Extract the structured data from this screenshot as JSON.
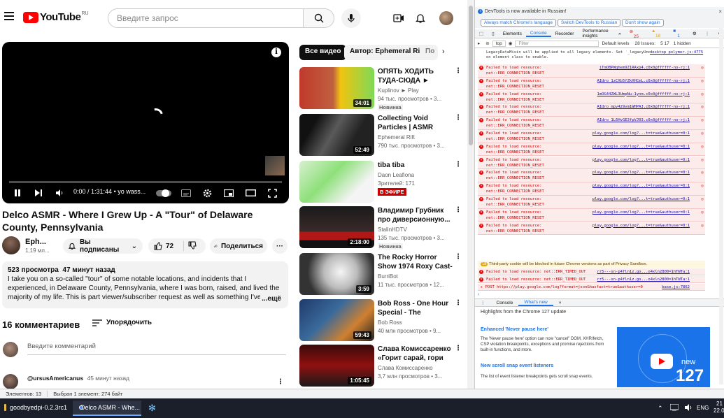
{
  "header": {
    "logo_text": "YouTube",
    "logo_region": "RU",
    "search_placeholder": "Введите запрос"
  },
  "player": {
    "time": "0:00 / 1:31:44",
    "chapter": "• yo wass..."
  },
  "video": {
    "title": "Delco ASMR - Where I Grew Up - A \"Tour\" of Delaware County, Pennsylvania",
    "channel": "Eph...",
    "subscribers": "1,19 мл...",
    "subscribe_label": "Вы подписаны",
    "likes": "72",
    "share_label": "Поделиться",
    "views": "523 просмотра",
    "posted": "47 минут назад",
    "description": "I take you on a so-called \"tour\" of some notable locations, and incidents that I experienced, in Delaware County, Pennsylvania, where I was born, raised, and lived the majority of my life. This is part viewer/subscriber request as well as something I've personally wanted to do since start",
    "more_label": "...ещё"
  },
  "comments": {
    "heading": "16 комментариев",
    "sort_label": "Упорядочить",
    "input_placeholder": "Введите комментарий",
    "first_author": "@ursusAmericanus",
    "first_time": "45 минут назад"
  },
  "chips": [
    "Все видео",
    "Автор: Ephemeral Rift",
    "По"
  ],
  "recommendations": [
    {
      "title": "ОПЯТЬ ХОДИТЬ ТУДА-СЮДА ► Hazing -...",
      "channel": "Kuplinov ► Play",
      "meta": "94 тыс. просмотров • 3...",
      "badge": "Новинка",
      "duration": "34:01"
    },
    {
      "title": "Collecting Void Particles | ASMR",
      "channel": "Ephemeral Rift",
      "meta": "790 тыс. просмотров • 3...",
      "badge": "",
      "duration": "52:49"
    },
    {
      "title": "tiba tiba",
      "channel": "Daon Leafiona",
      "meta": "Зрителей: 171",
      "badge": "",
      "live": "В ЭФИРЕ",
      "duration": ""
    },
    {
      "title": "Владимир Грубник про диверсионную...",
      "channel": "StalinHDTV",
      "meta": "135 тыс. просмотров • 3...",
      "badge": "Новинка",
      "duration": "2:18:00"
    },
    {
      "title": "The Rocky Horror Show 1974 Roxy Cast- The...",
      "channel": "BurriBot",
      "meta": "11 тыс. просмотров • 12...",
      "badge": "",
      "duration": "3:59"
    },
    {
      "title": "Bob Ross - One Hour Special - The Grandeu...",
      "channel": "Bob Ross",
      "meta": "40 млн просмотров • 9...",
      "badge": "",
      "duration": "59:43"
    },
    {
      "title": "Слава Комиссаренко «Горит сарай, гори и...",
      "channel": "Слава Комиссаренко",
      "meta": "3,7 млн просмотров • 3...",
      "badge": "",
      "duration": "1:05:45"
    }
  ],
  "devtools": {
    "banner": "DevTools is now available in Russian!",
    "btn_match": "Always match Chrome's language",
    "btn_switch": "Switch DevTools to Russian",
    "btn_dont": "Don't show again",
    "tabs": [
      "Elements",
      "Console",
      "Recorder",
      "Performance insights"
    ],
    "errors": "25",
    "warnings": "18",
    "info": "1",
    "context": "top",
    "filter_placeholder": "Filter",
    "levels": "Default levels",
    "issues": "28 Issues:",
    "issues_counts": "5  17",
    "hidden": "1 hidden",
    "first_log": "LegacyDataMixin will be applied to all legacy elements. Set `_legacyUndefinedCheck: true` on element class to enable.",
    "first_log_src": "desktop_polymer.js:4775",
    "logs": [
      {
        "msg": "Failed to load resource: net::ERR_CONNECTION_RESET",
        "src": "iTmOBPWqhem9Z1RAxp4.c0x0@ffffff-no-rj:1"
      },
      {
        "msg": "Failed to load resource: net::ERR_CONNECTION_RESET",
        "src": "AIdro_1zCXb5fZkXHCmL.c0x0@ffffff-no-rj:1"
      },
      {
        "msg": "Failed to load resource: net::ERR_CONNECTION_RESET",
        "src": "1mOG44ZWL3UmpNu-1ynm.c0x0@ffffff-no-rj:1"
      },
      {
        "msg": "Failed to load resource: net::ERR_CONNECTION_RESET",
        "src": "AIdro_mpv429vm1WHPAJ.c0x0@ffffff-no-rj:1"
      },
      {
        "msg": "Failed to load resource: net::ERR_CONNECTION_RESET",
        "src": "AIdro_1L6HvGE3fpVJ03.c0x0@ffffff-no-rj:1"
      },
      {
        "msg": "Failed to load resource: net::ERR_CONNECTION_RESET",
        "src": "play.google.com/log?...t=true&authuser=0:1"
      },
      {
        "msg": "Failed to load resource: net::ERR_CONNECTION_RESET",
        "src": "play.google.com/log?...t=true&authuser=0:1"
      },
      {
        "msg": "Failed to load resource: net::ERR_CONNECTION_RESET",
        "src": "play.google.com/log?...t=true&authuser=0:1"
      },
      {
        "msg": "Failed to load resource: net::ERR_CONNECTION_RESET",
        "src": "play.google.com/log?...t=true&authuser=0:1"
      },
      {
        "msg": "Failed to load resource: net::ERR_CONNECTION_RESET",
        "src": "play.google.com/log?...t=true&authuser=0:1"
      },
      {
        "msg": "Failed to load resource: net::ERR_CONNECTION_RESET",
        "src": "play.google.com/log?...t=true&authuser=0:1"
      },
      {
        "msg": "Failed to load resource: net::ERR_CONNECTION_RESET",
        "src": "play.google.com/log?...t=true&authuser=0:1"
      },
      {
        "msg": "Failed to load resource: net::ERR_CONNECTION_RESET",
        "src": "play.google.com/log?...t=true&authuser=0:1"
      }
    ],
    "warn_count": "18",
    "warn_msg": "Third-party cookie will be blocked in future Chrome versions as part of Privacy Sandbox.",
    "timeout1": "Failed to load resource: net::ERR_TIMED_OUT",
    "timeout1_src": "rr5---sn-p4fln1z.go...o4xln2800=1hTWTa:1",
    "timeout2": "Failed to load resource: net::ERR_TIMED_OUT",
    "timeout2_src": "rr5---sn-p4fln1z.go...o4xln2800=1hTWTa:1",
    "post": "▸ POST https://play.google.com/log?format=json&hasfast=true&authuser=0",
    "post_src": "base.js:7862",
    "drawer_tabs": [
      "Console",
      "What's new"
    ],
    "wn_header": "Highlights from the Chrome 127 update",
    "wn1_title": "Enhanced 'Never pause here'",
    "wn1_text": "The 'Never pause here' option can now \"cancel\" DOM, XHR/fetch, CSP violation breakpoints, exceptions and promise rejections from built-in functions, and more.",
    "wn2_title": "New scroll snap event listeners",
    "wn2_text": "The list of event listener breakpoints gets scroll snap events.",
    "promo_new": "new",
    "promo_num": "127"
  },
  "statusbar": {
    "elements": "Элементов: 13",
    "selected": "Выбран 1 элемент: 274 байт"
  },
  "taskbar": {
    "item1": "goodbyedpi-0.2.3rc1",
    "item2": "Delco ASMR - Whe...",
    "lang": "ENG",
    "time": "21",
    "date": "22.08"
  },
  "colors": {
    "brand": "#ff0000",
    "error_bg": "#fcebeb",
    "link": "#1a73e8",
    "taskbar": "#1b1f2a"
  }
}
